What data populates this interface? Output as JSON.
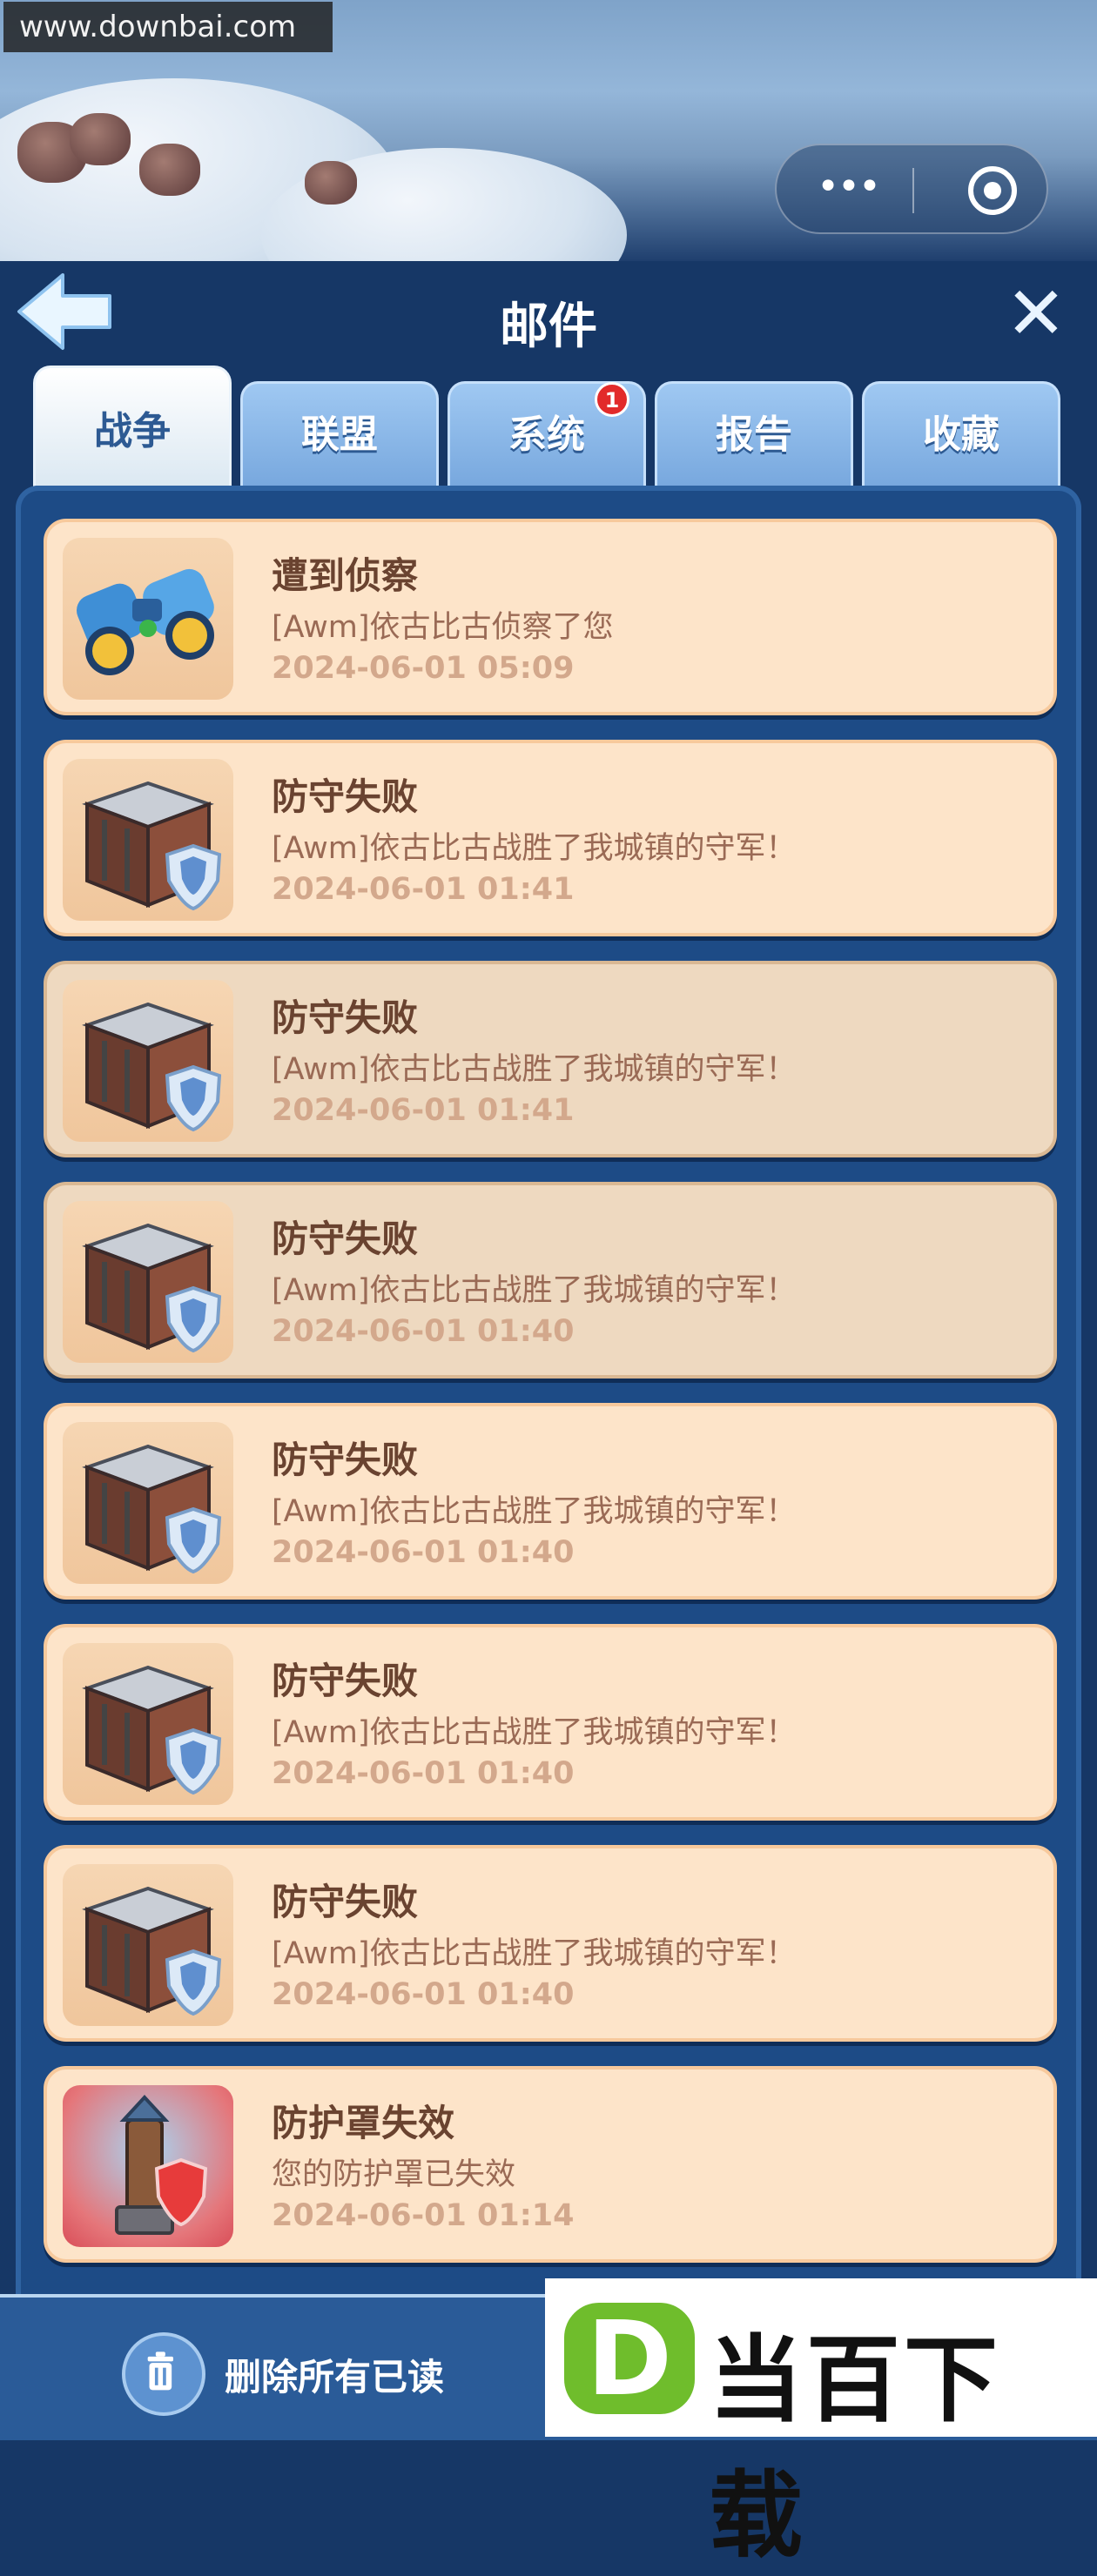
{
  "watermark_url": "www.downbai.com",
  "header": {
    "title": "邮件"
  },
  "tabs": [
    {
      "label": "战争",
      "active": true
    },
    {
      "label": "联盟",
      "active": false
    },
    {
      "label": "系统",
      "active": false,
      "badge": "1"
    },
    {
      "label": "报告",
      "active": false
    },
    {
      "label": "收藏",
      "active": false
    }
  ],
  "mails": [
    {
      "icon": "binoculars-icon",
      "title": "遭到侦察",
      "body": "[Awm]依古比古侦察了您",
      "time": "2024-06-01 05:09",
      "read": false
    },
    {
      "icon": "castle-shield-icon",
      "title": "防守失败",
      "body": "[Awm]依古比古战胜了我城镇的守军！",
      "time": "2024-06-01 01:41",
      "read": false
    },
    {
      "icon": "castle-shield-icon",
      "title": "防守失败",
      "body": "[Awm]依古比古战胜了我城镇的守军！",
      "time": "2024-06-01 01:41",
      "read": true
    },
    {
      "icon": "castle-shield-icon",
      "title": "防守失败",
      "body": "[Awm]依古比古战胜了我城镇的守军！",
      "time": "2024-06-01 01:40",
      "read": true
    },
    {
      "icon": "castle-shield-icon",
      "title": "防守失败",
      "body": "[Awm]依古比古战胜了我城镇的守军！",
      "time": "2024-06-01 01:40",
      "read": false
    },
    {
      "icon": "castle-shield-icon",
      "title": "防守失败",
      "body": "[Awm]依古比古战胜了我城镇的守军！",
      "time": "2024-06-01 01:40",
      "read": false
    },
    {
      "icon": "castle-shield-icon",
      "title": "防守失败",
      "body": "[Awm]依古比古战胜了我城镇的守军！",
      "time": "2024-06-01 01:40",
      "read": false
    },
    {
      "icon": "tower-shield-icon",
      "title": "防护罩失效",
      "body": "您的防护罩已失效",
      "time": "2024-06-01 01:14",
      "read": false
    }
  ],
  "bottom": {
    "delete_all_read_label": "删除所有已读"
  },
  "brand": {
    "letter": "D",
    "name": "当百下载"
  },
  "colors": {
    "card": "#fde4c9",
    "card_read": "#eed9c0",
    "panel": "#1d4b86",
    "tab": "#78a8de",
    "badge": "#e22a2a"
  }
}
